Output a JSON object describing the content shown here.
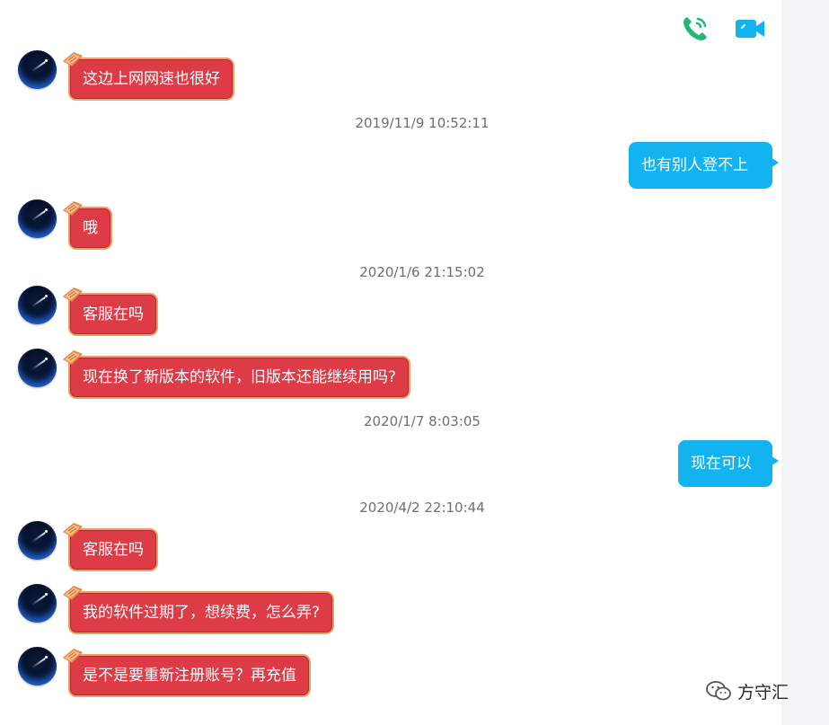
{
  "header": {
    "voice_call_color": "#1fb978",
    "video_call_color": "#12b3f0"
  },
  "messages": [
    {
      "side": "in",
      "text": "这边上网网速也很好"
    },
    {
      "side": "time",
      "text": "2019/11/9 10:52:11"
    },
    {
      "side": "out",
      "text": "也有别人登不上"
    },
    {
      "side": "in",
      "text": "哦"
    },
    {
      "side": "time",
      "text": "2020/1/6 21:15:02"
    },
    {
      "side": "in",
      "text": "客服在吗"
    },
    {
      "side": "in",
      "text": "现在换了新版本的软件，旧版本还能继续用吗?"
    },
    {
      "side": "time",
      "text": "2020/1/7 8:03:05"
    },
    {
      "side": "out",
      "text": "现在可以"
    },
    {
      "side": "time",
      "text": "2020/4/2 22:10:44"
    },
    {
      "side": "in",
      "text": "客服在吗"
    },
    {
      "side": "in",
      "text": "我的软件过期了，想续费，怎么弄?"
    },
    {
      "side": "in",
      "text": "是不是要重新注册账号？再充值"
    }
  ],
  "watermark": {
    "text": "方守汇",
    "icon": "wechat-official-account-icon"
  },
  "colors": {
    "incoming_bubble": "#dd3b45",
    "incoming_border": "#e8a06a",
    "outgoing_bubble": "#12b3f0",
    "timestamp_text": "#6f6f6f"
  }
}
